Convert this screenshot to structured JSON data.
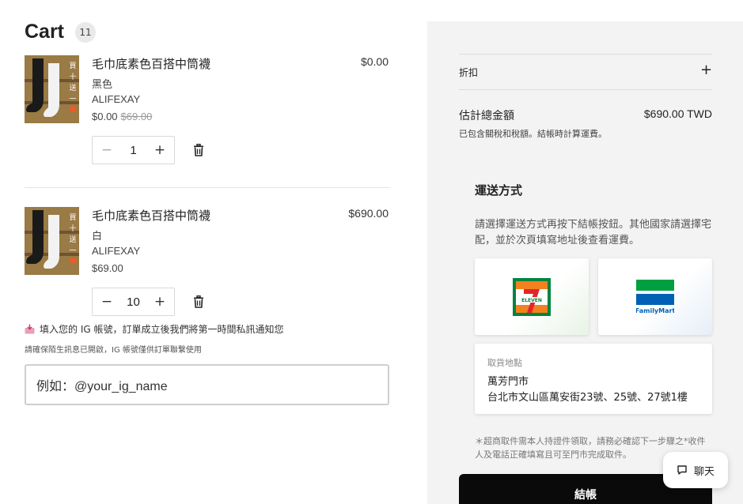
{
  "cart": {
    "title": "Cart",
    "count": "11"
  },
  "items": [
    {
      "name": "毛巾底素色百搭中筒襪",
      "variant": "黑色",
      "vendor": "ALIFEXAY",
      "price": "$0.00",
      "compare_price": "$69.00",
      "line_total": "$0.00",
      "quantity": "1",
      "thumb_text": "買十送一"
    },
    {
      "name": "毛巾底素色百搭中筒襪",
      "variant": "白",
      "vendor": "ALIFEXAY",
      "price": "$69.00",
      "line_total": "$690.00",
      "quantity": "10",
      "thumb_text": "買十送一"
    }
  ],
  "ig": {
    "note": "填入您的 IG 帳號，訂單成立後我們將第一時間私訊通知您",
    "sub_note": "請確保陌生訊息已開啟，IG 帳號僅供訂單聯繫使用",
    "placeholder": "例如：@your_ig_name"
  },
  "summary": {
    "discount_label": "折扣",
    "estimated_label": "估計總金額",
    "estimated_value": "$690.00 TWD",
    "tax_note": "已包含關稅和稅額。結帳時計算運費。"
  },
  "shipping": {
    "title": "運送方式",
    "description": "請選擇運送方式再按下結帳按鈕。其他國家請選擇宅配，並於次頁填寫地址後查看運費。",
    "seven_eleven_label": "ELEVEN",
    "familymart_label": "FamilyMart",
    "pickup_label": "取貨地點",
    "pickup_store": "萬芳門市",
    "pickup_address": "台北市文山區萬安街23號、25號、27號1樓",
    "note": "＊超商取件需本人持證件領取，請務必確認下一步驟之*收件人及電話正確填寫且可至門市完成取件。"
  },
  "checkout_label": "結帳",
  "chat_label": "聊天",
  "colors": {
    "checkout_bg": "#0a0a0a",
    "panel_bg": "#f3f3f3",
    "seven_green": "#00843d",
    "seven_orange": "#f48120",
    "seven_red": "#e3262a",
    "fm_green": "#00a040",
    "fm_blue": "#0060b5"
  }
}
